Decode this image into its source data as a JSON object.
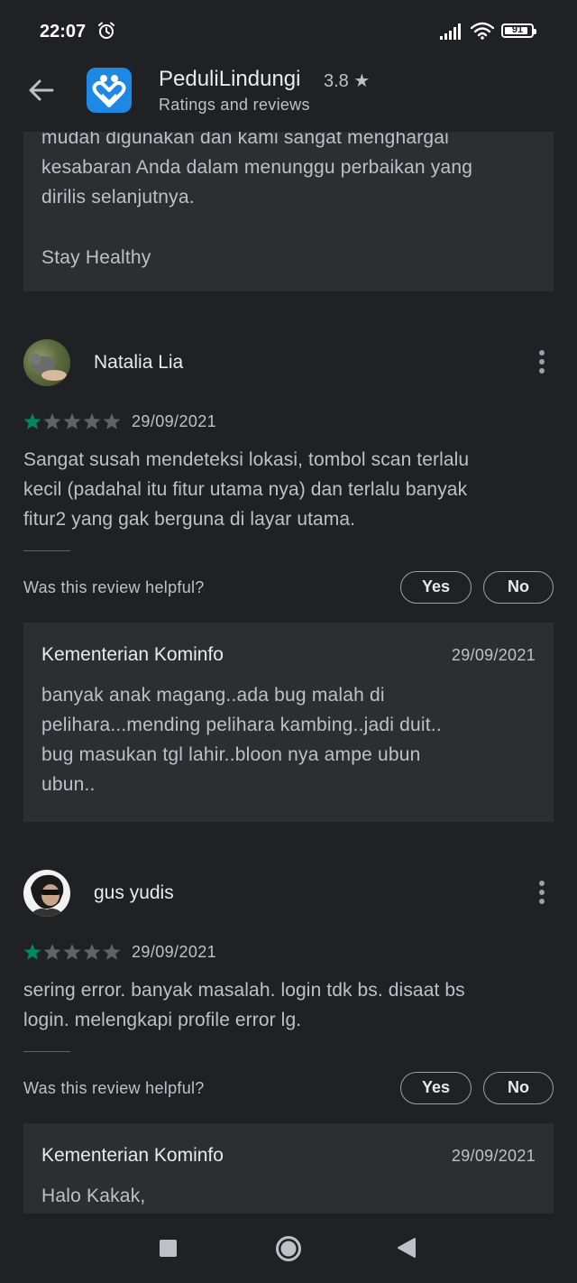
{
  "status": {
    "time": "22:07",
    "battery": "91"
  },
  "app": {
    "title": "PeduliLindungi",
    "rating": "3.8 ★",
    "subtitle": "Ratings and reviews"
  },
  "top_reply": {
    "lines": [
      "mudah digunakan dan kami sangat menghargai",
      "kesabaran Anda dalam menunggu perbaikan yang",
      "dirilis selanjutnya."
    ],
    "signoff": "Stay Healthy"
  },
  "reviews": [
    {
      "author": "Natalia Lia",
      "stars": 1,
      "date": "29/09/2021",
      "text": [
        "Sangat susah mendeteksi lokasi, tombol scan terlalu",
        "kecil (padahal itu fitur utama nya) dan terlalu banyak",
        "fitur2 yang gak berguna di layar utama."
      ],
      "helpful": "Was this review helpful?",
      "yes": "Yes",
      "no": "No",
      "reply": {
        "author": "Kementerian Kominfo",
        "date": "29/09/2021",
        "text": [
          "banyak anak magang..ada bug malah di",
          "pelihara...mending pelihara kambing..jadi duit..",
          "bug masukan tgl lahir..bloon nya ampe ubun",
          "ubun.."
        ]
      }
    },
    {
      "author": "gus yudis",
      "stars": 1,
      "date": "29/09/2021",
      "text": [
        "sering error. banyak masalah. login tdk bs. disaat bs",
        "login. melengkapi profile error lg."
      ],
      "helpful": "Was this review helpful?",
      "yes": "Yes",
      "no": "No",
      "reply": {
        "author": "Kementerian Kominfo",
        "date": "29/09/2021",
        "text": [
          "Halo Kakak,"
        ]
      }
    }
  ],
  "colors": {
    "star_filled": "#01875f",
    "star_empty": "#5f6368",
    "accent": "#1e88e5"
  },
  "icons": [
    "back-arrow-icon",
    "alarm-icon",
    "signal-icon",
    "wifi-icon",
    "battery-icon",
    "more-vert-icon",
    "star-icon",
    "nav-recents-icon",
    "nav-home-icon",
    "nav-back-icon"
  ]
}
